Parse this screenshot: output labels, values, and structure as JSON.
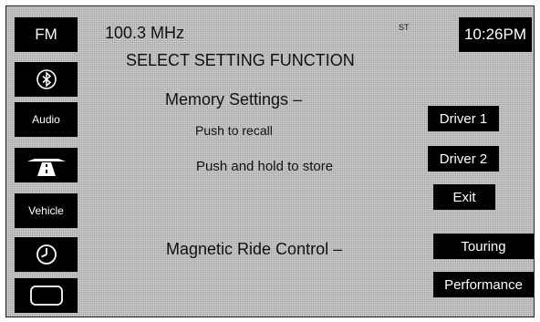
{
  "sidebar": {
    "fm_label": "FM",
    "bluetooth_icon": "bluetooth-icon",
    "audio_label": "Audio",
    "nav_icon": "road-icon",
    "vehicle_label": "Vehicle",
    "clock_icon": "clock-icon",
    "display_icon": "screen-icon"
  },
  "header": {
    "frequency": "100.3 MHz",
    "stereo_indicator": "ST",
    "time": "10:26PM",
    "title": "SELECT SETTING FUNCTION"
  },
  "memory": {
    "heading": "Memory Settings –",
    "recall_hint": "Push to recall",
    "store_hint": "Push and hold to store"
  },
  "ride": {
    "heading": "Magnetic Ride Control –"
  },
  "buttons": {
    "driver1": "Driver 1",
    "driver2": "Driver 2",
    "exit": "Exit",
    "touring": "Touring",
    "performance": "Performance"
  },
  "colors": {
    "button_bg": "#000000",
    "button_fg": "#ffffff",
    "screen_bg": "#d6d6d6"
  }
}
